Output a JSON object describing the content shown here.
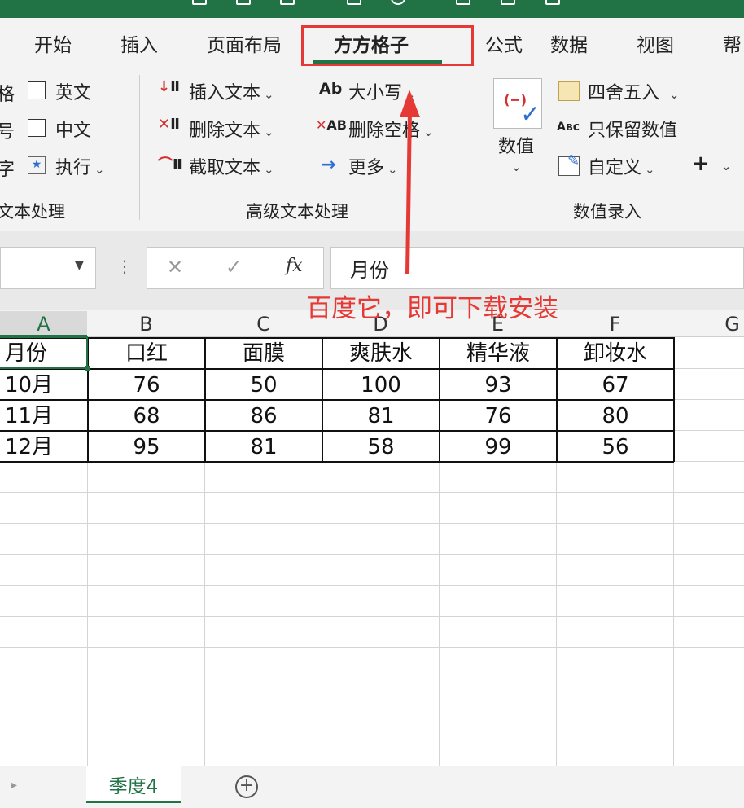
{
  "tabs": [
    {
      "label": "开始",
      "active": false
    },
    {
      "label": "插入",
      "active": false
    },
    {
      "label": "页面布局",
      "active": false
    },
    {
      "label": "方方格子",
      "active": true
    },
    {
      "label": "公式",
      "active": false
    },
    {
      "label": "数据",
      "active": false
    },
    {
      "label": "视图",
      "active": false
    },
    {
      "label": "帮",
      "active": false
    }
  ],
  "ribbon": {
    "group1": {
      "edge_chars": [
        "格",
        "号",
        "字"
      ],
      "items": [
        "英文",
        "中文",
        "执行"
      ],
      "label": "文本处理"
    },
    "group2": {
      "col1": [
        "插入文本",
        "删除文本",
        "截取文本"
      ],
      "col2": [
        "大小写",
        "删除空格",
        "更多"
      ],
      "col2_icons": [
        "Ab",
        "AB",
        "→"
      ],
      "label": "高级文本处理"
    },
    "group3": {
      "big_button": "数值",
      "items": [
        "四舍五入",
        "只保留数值",
        "自定义"
      ],
      "plus": "+",
      "label": "数值录入"
    }
  },
  "formula_bar": {
    "cancel": "✕",
    "confirm": "✓",
    "fx": "fx",
    "value": "月份"
  },
  "annotation": "百度它，即可下载安装",
  "grid": {
    "columns": [
      "A",
      "B",
      "C",
      "D",
      "E",
      "F",
      "G"
    ],
    "rows": [
      [
        "月份",
        "口红",
        "面膜",
        "爽肤水",
        "精华液",
        "卸妆水"
      ],
      [
        "10月",
        "76",
        "50",
        "100",
        "93",
        "67"
      ],
      [
        "11月",
        "68",
        "86",
        "81",
        "76",
        "80"
      ],
      [
        "12月",
        "95",
        "81",
        "58",
        "99",
        "56"
      ]
    ]
  },
  "sheet": {
    "tab_label": "季度4",
    "add": "+"
  },
  "colors": {
    "accent": "#217346",
    "annotation": "#e53935"
  }
}
